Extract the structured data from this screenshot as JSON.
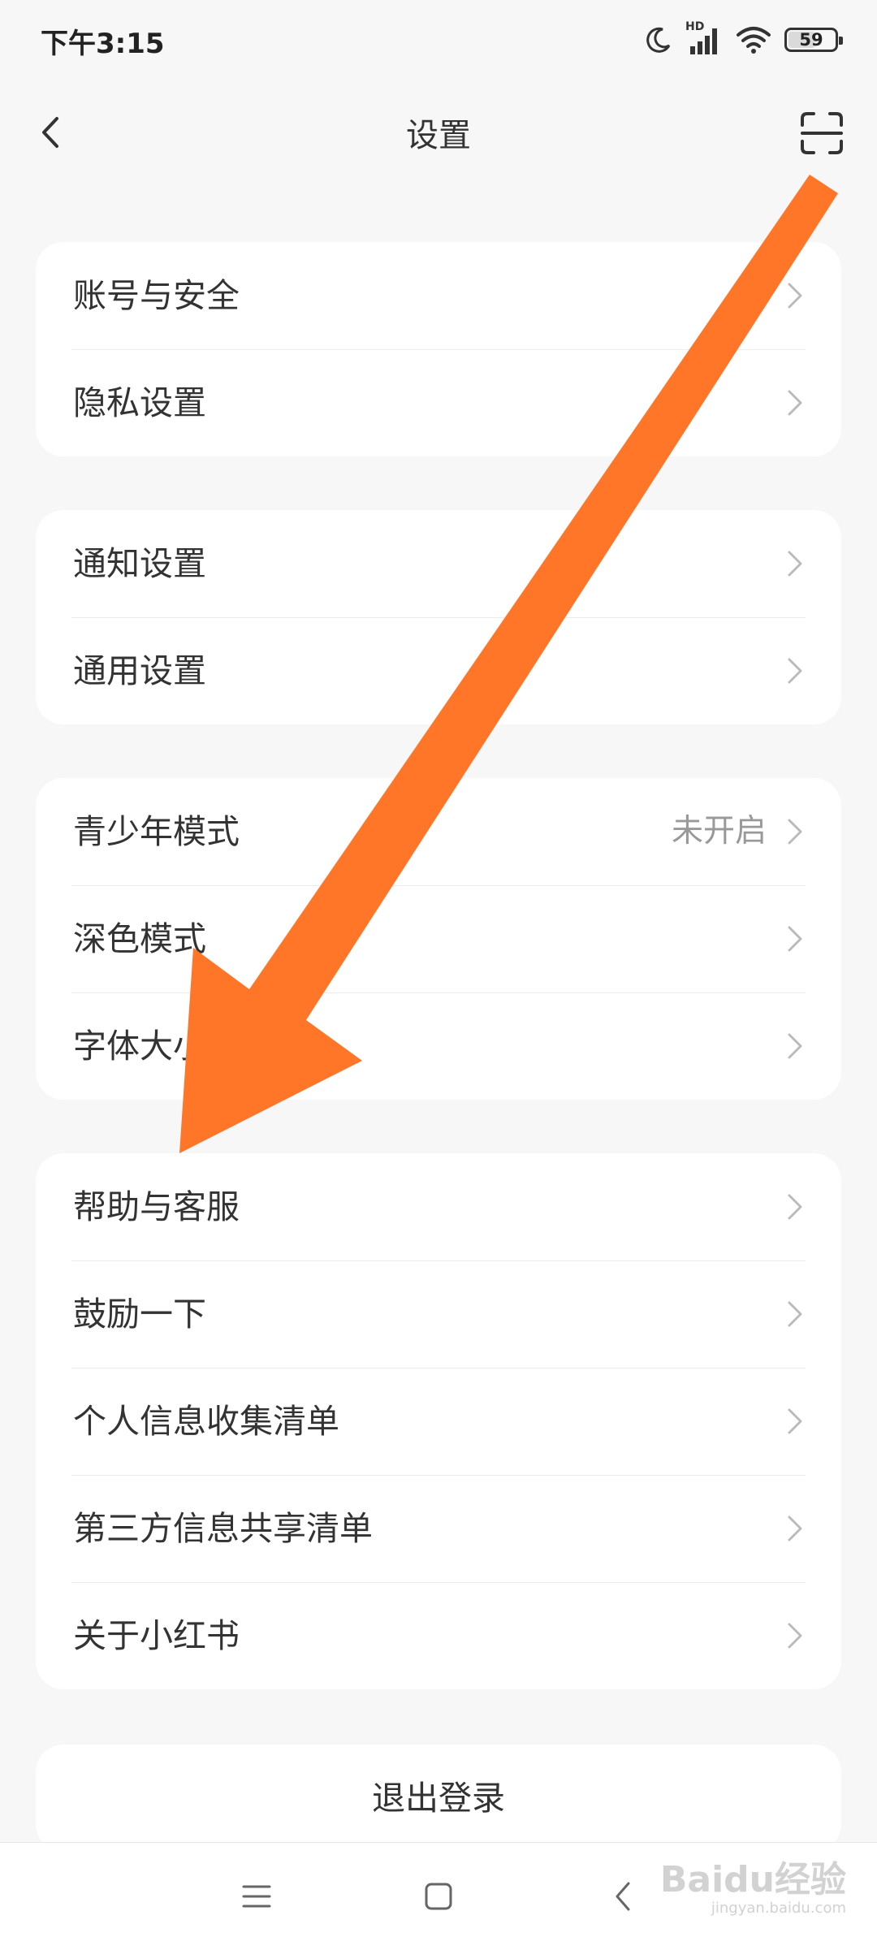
{
  "status_bar": {
    "time": "下午3:15",
    "network_label": "HD",
    "battery": "59",
    "battery_fraction": 0.59
  },
  "header": {
    "title": "设置",
    "back_icon": "chevron-left-icon",
    "scan_icon": "scan-icon"
  },
  "groups": [
    {
      "items": [
        {
          "label": "账号与安全"
        },
        {
          "label": "隐私设置"
        }
      ]
    },
    {
      "items": [
        {
          "label": "通知设置"
        },
        {
          "label": "通用设置"
        }
      ]
    },
    {
      "items": [
        {
          "label": "青少年模式",
          "value": "未开启"
        },
        {
          "label": "深色模式"
        },
        {
          "label": "字体大小"
        }
      ]
    },
    {
      "items": [
        {
          "label": "帮助与客服"
        },
        {
          "label": "鼓励一下"
        },
        {
          "label": "个人信息收集清单"
        },
        {
          "label": "第三方信息共享清单"
        },
        {
          "label": "关于小红书"
        }
      ]
    }
  ],
  "logout": {
    "label": "退出登录"
  },
  "nav": {
    "menu_icon": "menu-icon",
    "home_icon": "square-icon",
    "back_icon": "back-triangle-icon"
  },
  "watermark": {
    "main": "Baidu经验",
    "sub": "jingyan.baidu.com"
  },
  "colors": {
    "annotation_arrow": "#ff7628",
    "background": "#f7f7f7",
    "card": "#ffffff",
    "text": "#333333",
    "secondary_text": "#999999"
  }
}
